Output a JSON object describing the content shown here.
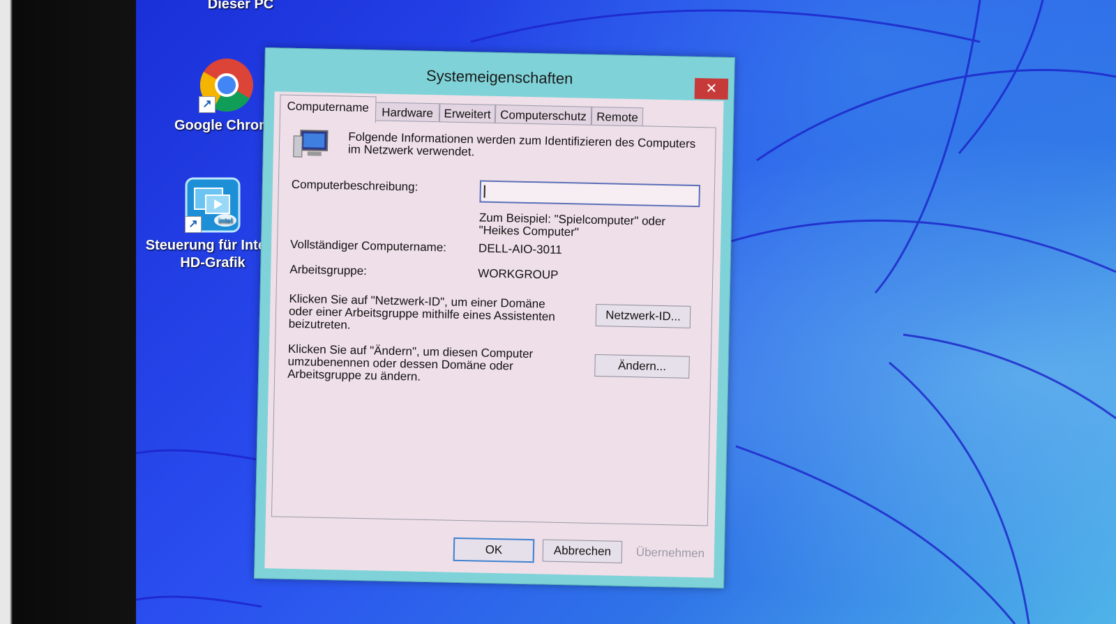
{
  "desktop": {
    "top_label": "Dieser PC",
    "icons": [
      {
        "label": "Google Chrome",
        "icon": "chrome-icon"
      },
      {
        "label_line1": "Steuerung für Intel®",
        "label_line2": "HD-Grafik",
        "icon": "intel-graphics-icon"
      }
    ]
  },
  "dialog": {
    "title": "Systemeigenschaften",
    "close_glyph": "✕",
    "tabs": [
      {
        "label": "Computername",
        "active": true
      },
      {
        "label": "Hardware"
      },
      {
        "label": "Erweitert"
      },
      {
        "label": "Computerschutz"
      },
      {
        "label": "Remote"
      }
    ],
    "computer_name_tab": {
      "intro_line1": "Folgende Informationen werden zum Identifizieren des Computers",
      "intro_line2": "im Netzwerk verwendet.",
      "description_label": "Computerbeschreibung:",
      "description_value": "",
      "example_line1": "Zum Beispiel: \"Spielcomputer\" oder",
      "example_line2": "\"Heikes Computer\"",
      "full_name_label": "Vollständiger Computername:",
      "full_name_value": "DELL-AIO-3011",
      "workgroup_label": "Arbeitsgruppe:",
      "workgroup_value": "WORKGROUP",
      "network_text_line1": "Klicken Sie auf \"Netzwerk-ID\", um einer Domäne",
      "network_text_line2": "oder einer Arbeitsgruppe mithilfe eines Assistenten",
      "network_text_line3": "beizutreten.",
      "network_button": "Netzwerk-ID...",
      "change_text_line1": "Klicken Sie auf \"Ändern\", um diesen Computer",
      "change_text_line2": "umzubenennen oder dessen Domäne oder",
      "change_text_line3": "Arbeitsgruppe zu ändern.",
      "change_button": "Ändern..."
    },
    "buttons": {
      "ok": "OK",
      "cancel": "Abbrechen",
      "apply": "Übernehmen"
    }
  }
}
